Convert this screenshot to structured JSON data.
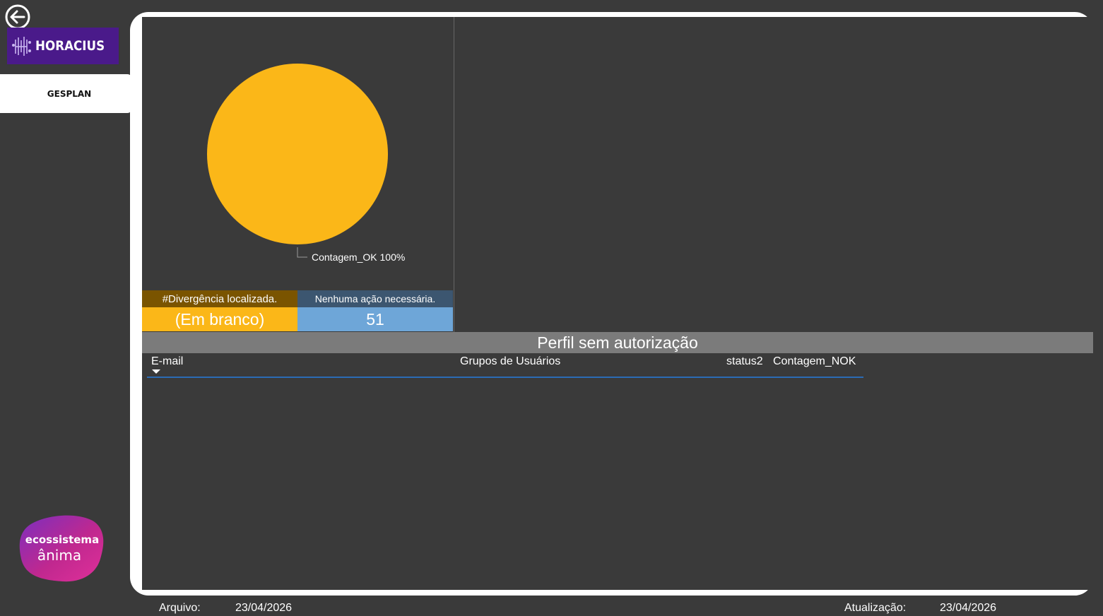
{
  "app": {
    "logo_text": "HORACIUS",
    "nav_items": [
      {
        "label": "GESPLAN"
      }
    ],
    "brand_logo": {
      "line1": "ecossistema",
      "line2": "ânima"
    }
  },
  "chart_data": {
    "type": "pie",
    "slices": [
      {
        "label": "Contagem_OK",
        "value": 100,
        "color": "#fbb718"
      }
    ],
    "data_label": "Contagem_OK 100%"
  },
  "cards": {
    "divergencia": {
      "header": "#Divergência localizada.",
      "value": "(Em branco)"
    },
    "acao": {
      "header": "Nenhuma ação necessária.",
      "value": "51"
    }
  },
  "table": {
    "title": "Perfil sem autorização",
    "columns": [
      "E-mail",
      "Grupos de Usuários",
      "status2",
      "Contagem_NOK"
    ],
    "rows": []
  },
  "footer": {
    "arquivo_label": "Arquivo:",
    "arquivo_value": "23/04/2026",
    "atualizacao_label": "Atualização:",
    "atualizacao_value": "23/04/2026"
  },
  "colors": {
    "background": "#3a3a3a",
    "accent_gold": "#fbb718",
    "accent_brown": "#7a5400",
    "accent_blue": "#6ea6d8",
    "accent_navy": "#3c5670",
    "brand_purple": "#4a1a8a"
  }
}
